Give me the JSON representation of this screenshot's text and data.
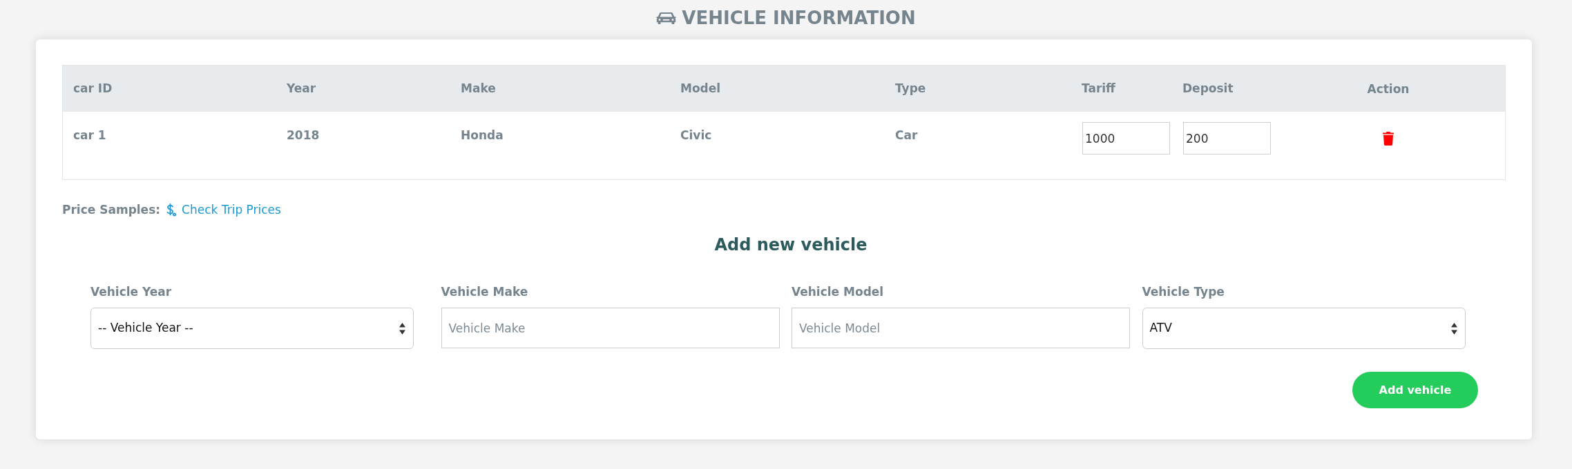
{
  "header": {
    "title": "VEHICLE INFORMATION"
  },
  "table": {
    "columns": [
      "car ID",
      "Year",
      "Make",
      "Model",
      "Type",
      "Tariff",
      "Deposit",
      "Action"
    ],
    "rows": [
      {
        "cells": [
          {
            "kind": "text",
            "value": "car 1"
          },
          {
            "kind": "text",
            "value": "2018"
          },
          {
            "kind": "text",
            "value": "Honda"
          },
          {
            "kind": "text",
            "value": "Civic"
          },
          {
            "kind": "text",
            "value": "Car"
          },
          {
            "kind": "input",
            "value": "1000"
          },
          {
            "kind": "input",
            "value": "200"
          },
          {
            "kind": "delete"
          }
        ]
      }
    ]
  },
  "price_samples": {
    "label": "Price Samples:",
    "link": "Check Trip Prices"
  },
  "add_form": {
    "title": "Add new vehicle",
    "fields": [
      {
        "kind": "select",
        "label": "Vehicle Year",
        "value": "-- Vehicle Year --"
      },
      {
        "kind": "input",
        "label": "Vehicle Make",
        "placeholder": "Vehicle Make"
      },
      {
        "kind": "input",
        "label": "Vehicle Model",
        "placeholder": "Vehicle Model"
      },
      {
        "kind": "select",
        "label": "Vehicle Type",
        "value": "ATV"
      }
    ],
    "submit": "Add vehicle"
  }
}
